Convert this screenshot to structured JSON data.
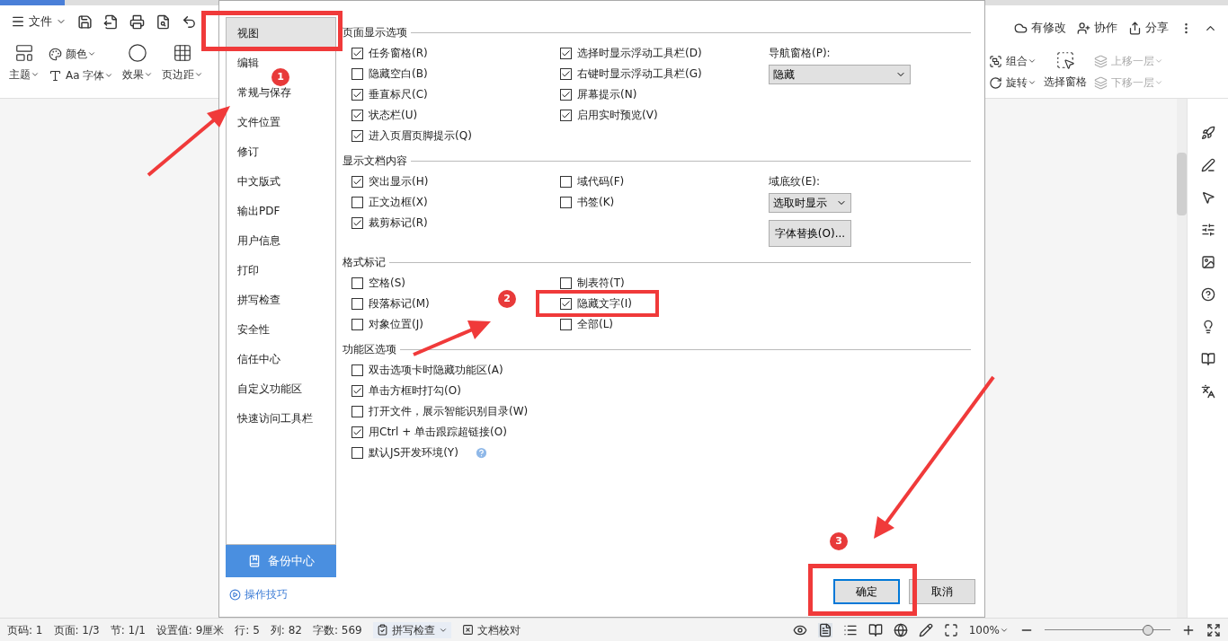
{
  "toolbar": {
    "file_menu": "文件"
  },
  "ribbon_left": [
    {
      "kind": "theme",
      "label": "主题"
    },
    {
      "kind": "color",
      "label": "颜色"
    },
    {
      "kind": "font",
      "label": "Aa 字体"
    },
    {
      "kind": "effect",
      "label": "效果"
    },
    {
      "kind": "margin",
      "label": "页边距"
    }
  ],
  "top_right": [
    {
      "kind": "changes",
      "label": "有修改"
    },
    {
      "kind": "collab",
      "label": "协作"
    },
    {
      "kind": "share",
      "label": "分享"
    }
  ],
  "ribbon_right": [
    {
      "kind": "group",
      "label": "组合",
      "disabled": false
    },
    {
      "kind": "rotate",
      "label": "旋转",
      "disabled": false
    },
    {
      "kind": "pane",
      "label": "选择窗格",
      "disabled": false
    },
    {
      "kind": "up",
      "label": "上移一层",
      "disabled": true
    },
    {
      "kind": "down",
      "label": "下移一层",
      "disabled": true
    }
  ],
  "dialog": {
    "nav": [
      {
        "label": "视图",
        "selected": true
      },
      {
        "label": "编辑",
        "selected": false
      },
      {
        "label": "常规与保存",
        "selected": false
      },
      {
        "label": "文件位置",
        "selected": false
      },
      {
        "label": "修订",
        "selected": false
      },
      {
        "label": "中文版式",
        "selected": false
      },
      {
        "label": "输出PDF",
        "selected": false
      },
      {
        "label": "用户信息",
        "selected": false
      },
      {
        "label": "打印",
        "selected": false
      },
      {
        "label": "拼写检查",
        "selected": false
      },
      {
        "label": "安全性",
        "selected": false
      },
      {
        "label": "信任中心",
        "selected": false
      },
      {
        "label": "自定义功能区",
        "selected": false
      },
      {
        "label": "快速访问工具栏",
        "selected": false
      }
    ],
    "backup": "备份中心",
    "tips": "操作技巧",
    "sections": [
      {
        "title": "页面显示选项",
        "columns": [
          [
            {
              "label": "任务窗格(R)",
              "checked": true
            },
            {
              "label": "隐藏空白(B)",
              "checked": false
            },
            {
              "label": "垂直标尺(C)",
              "checked": true
            },
            {
              "label": "状态栏(U)",
              "checked": true
            },
            {
              "label": "进入页眉页脚提示(Q)",
              "checked": true
            }
          ],
          [
            {
              "label": "选择时显示浮动工具栏(D)",
              "checked": true
            },
            {
              "label": "右键时显示浮动工具栏(G)",
              "checked": true
            },
            {
              "label": "屏幕提示(N)",
              "checked": true
            },
            {
              "label": "启用实时预览(V)",
              "checked": true
            }
          ]
        ],
        "side": {
          "label": "导航窗格(P):",
          "select": "隐藏"
        }
      },
      {
        "title": "显示文档内容",
        "columns": [
          [
            {
              "label": "突出显示(H)",
              "checked": true
            },
            {
              "label": "正文边框(X)",
              "checked": false
            },
            {
              "label": "裁剪标记(R)",
              "checked": true
            }
          ],
          [
            {
              "label": "域代码(F)",
              "checked": false
            },
            {
              "label": "书签(K)",
              "checked": false
            }
          ]
        ],
        "side": {
          "label": "域底纹(E):",
          "select": "选取时显示",
          "button": "字体替换(O)..."
        }
      },
      {
        "title": "格式标记",
        "columns": [
          [
            {
              "label": "空格(S)",
              "checked": false
            },
            {
              "label": "段落标记(M)",
              "checked": false
            },
            {
              "label": "对象位置(J)",
              "checked": false
            }
          ],
          [
            {
              "label": "制表符(T)",
              "checked": false
            },
            {
              "label": "隐藏文字(I)",
              "checked": true
            },
            {
              "label": "全部(L)",
              "checked": false
            }
          ]
        ]
      },
      {
        "title": "功能区选项",
        "columns": [
          [
            {
              "label": "双击选项卡时隐藏功能区(A)",
              "checked": false,
              "help": false
            },
            {
              "label": "单击方框时打勾(O)",
              "checked": true,
              "help": false
            },
            {
              "label": "打开文件，展示智能识别目录(W)",
              "checked": false,
              "help": false
            },
            {
              "label": "用Ctrl + 单击跟踪超链接(O)",
              "checked": true,
              "help": false
            },
            {
              "label": "默认JS开发环境(Y)",
              "checked": false,
              "help": true
            }
          ]
        ]
      }
    ],
    "buttons": [
      "确定",
      "取消"
    ]
  },
  "status_bar": {
    "items": [
      "页码: 1",
      "页面: 1/3",
      "节: 1/1",
      "设置值: 9厘米",
      "行: 5",
      "列: 82",
      "字数: 569"
    ],
    "spell": "拼写检查",
    "proof": "文档校对",
    "zoom": "100%",
    "zoom_level": {
      "level": 0.82
    }
  },
  "annotations": [
    {
      "number": "1"
    },
    {
      "number": "2"
    },
    {
      "number": "3"
    }
  ]
}
